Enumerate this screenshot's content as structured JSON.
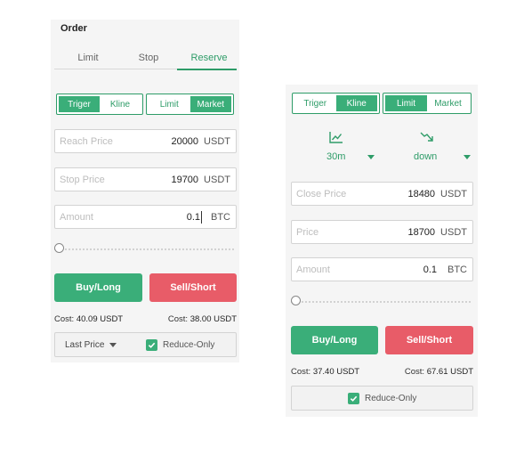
{
  "left": {
    "title": "Order",
    "tabs": [
      "Limit",
      "Stop",
      "Reserve"
    ],
    "trigger_toggle": [
      "Triger",
      "Kline"
    ],
    "price_toggle": [
      "Limit",
      "Market"
    ],
    "fields": [
      {
        "placeholder": "Reach Price",
        "value": "20000",
        "unit": "USDT"
      },
      {
        "placeholder": "Stop Price",
        "value": "19700",
        "unit": "USDT"
      },
      {
        "placeholder": "Amount",
        "value": "0.1",
        "unit": "BTC"
      }
    ],
    "buy_label": "Buy/Long",
    "sell_label": "Sell/Short",
    "cost_label": "Cost:",
    "buy_cost": "40.09 USDT",
    "sell_cost": "38.00 USDT",
    "select_value": "Last Price",
    "reduce_only": "Reduce-Only",
    "slider_value": 0
  },
  "right": {
    "trigger_toggle": [
      "Triger",
      "Kline"
    ],
    "price_toggle": [
      "Limit",
      "Market"
    ],
    "interval": "30m",
    "direction": "down",
    "fields": [
      {
        "placeholder": "Close Price",
        "value": "18480",
        "unit": "USDT"
      },
      {
        "placeholder": "Price",
        "value": "18700",
        "unit": "USDT"
      },
      {
        "placeholder": "Amount",
        "value": "0.1",
        "unit": "BTC"
      }
    ],
    "buy_label": "Buy/Long",
    "sell_label": "Sell/Short",
    "cost_label": "Cost:",
    "buy_cost": "37.40 USDT",
    "sell_cost": "67.61 USDT",
    "reduce_only": "Reduce-Only",
    "slider_value": 0
  },
  "colors": {
    "accent": "#3aae79",
    "sell": "#e85c68",
    "panel": "#f5f5f5"
  }
}
